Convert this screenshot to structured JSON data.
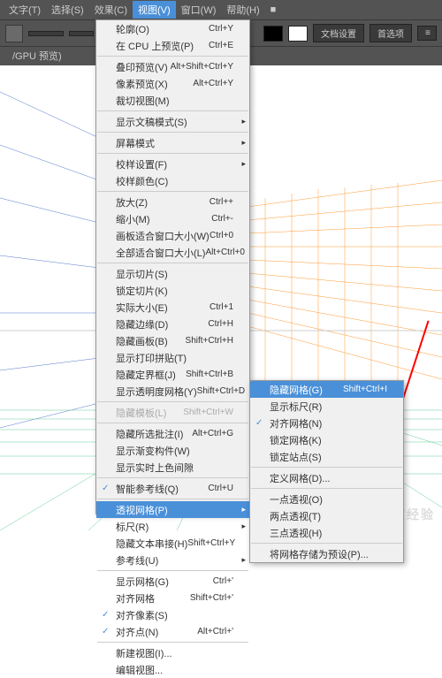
{
  "menubar": {
    "items": [
      "文字(T)",
      "选择(S)",
      "效果(C)",
      "视图(V)",
      "窗口(W)",
      "帮助(H)",
      "■"
    ],
    "active": 3
  },
  "toolbar": {
    "zoom": "",
    "doc": "文档设置",
    "pref": "首选项"
  },
  "subbar": {
    "tab": "/GPU 预览)"
  },
  "menu": [
    {
      "t": "轮廓(O)",
      "s": "Ctrl+Y"
    },
    {
      "t": "在 CPU 上预览(P)",
      "s": "Ctrl+E"
    },
    {
      "sep": 1
    },
    {
      "t": "叠印预览(V)",
      "s": "Alt+Shift+Ctrl+Y"
    },
    {
      "t": "像素预览(X)",
      "s": "Alt+Ctrl+Y"
    },
    {
      "t": "裁切视图(M)"
    },
    {
      "sep": 1
    },
    {
      "t": "显示文稿模式(S)",
      "sub": 1
    },
    {
      "sep": 1
    },
    {
      "t": "屏幕模式",
      "sub": 1
    },
    {
      "sep": 1
    },
    {
      "t": "校样设置(F)",
      "sub": 1
    },
    {
      "t": "校样颜色(C)"
    },
    {
      "sep": 1
    },
    {
      "t": "放大(Z)",
      "s": "Ctrl++"
    },
    {
      "t": "缩小(M)",
      "s": "Ctrl+-"
    },
    {
      "t": "画板适合窗口大小(W)",
      "s": "Ctrl+0"
    },
    {
      "t": "全部适合窗口大小(L)",
      "s": "Alt+Ctrl+0"
    },
    {
      "sep": 1
    },
    {
      "t": "显示切片(S)"
    },
    {
      "t": "锁定切片(K)"
    },
    {
      "t": "实际大小(E)",
      "s": "Ctrl+1"
    },
    {
      "t": "隐藏边缘(D)",
      "s": "Ctrl+H"
    },
    {
      "t": "隐藏画板(B)",
      "s": "Shift+Ctrl+H"
    },
    {
      "t": "显示打印拼贴(T)"
    },
    {
      "t": "隐藏定界框(J)",
      "s": "Shift+Ctrl+B"
    },
    {
      "t": "显示透明度网格(Y)",
      "s": "Shift+Ctrl+D"
    },
    {
      "sep": 1
    },
    {
      "t": "隐藏模板(L)",
      "s": "Shift+Ctrl+W",
      "dis": 1
    },
    {
      "sep": 1
    },
    {
      "t": "隐藏所选批注(I)",
      "s": "Alt+Ctrl+G"
    },
    {
      "t": "显示渐变构件(W)"
    },
    {
      "t": "显示实时上色间隙"
    },
    {
      "sep": 1
    },
    {
      "t": "智能参考线(Q)",
      "s": "Ctrl+U",
      "chk": 1
    },
    {
      "sep": 1
    },
    {
      "t": "透视网格(P)",
      "sub": 1,
      "hl": 1
    },
    {
      "t": "标尺(R)",
      "sub": 1
    },
    {
      "t": "隐藏文本串接(H)",
      "s": "Shift+Ctrl+Y"
    },
    {
      "t": "参考线(U)",
      "sub": 1
    },
    {
      "sep": 1
    },
    {
      "t": "显示网格(G)",
      "s": "Ctrl+'"
    },
    {
      "t": "对齐网格",
      "s": "Shift+Ctrl+'"
    },
    {
      "t": "对齐像素(S)",
      "chk": 1
    },
    {
      "t": "对齐点(N)",
      "s": "Alt+Ctrl+'",
      "chk": 1
    },
    {
      "sep": 1
    },
    {
      "t": "新建视图(I)..."
    },
    {
      "t": "编辑视图..."
    }
  ],
  "submenu": [
    {
      "t": "隐藏网格(G)",
      "s": "Shift+Ctrl+I",
      "hl": 1
    },
    {
      "t": "显示标尺(R)"
    },
    {
      "t": "对齐网格(N)",
      "chk": 1
    },
    {
      "t": "锁定网格(K)"
    },
    {
      "t": "锁定站点(S)"
    },
    {
      "sep": 1
    },
    {
      "t": "定义网格(D)..."
    },
    {
      "sep": 1
    },
    {
      "t": "一点透视(O)"
    },
    {
      "t": "两点透视(T)"
    },
    {
      "t": "三点透视(H)"
    },
    {
      "sep": 1
    },
    {
      "t": "将网格存储为预设(P)..."
    }
  ],
  "watermark": "百度经验"
}
